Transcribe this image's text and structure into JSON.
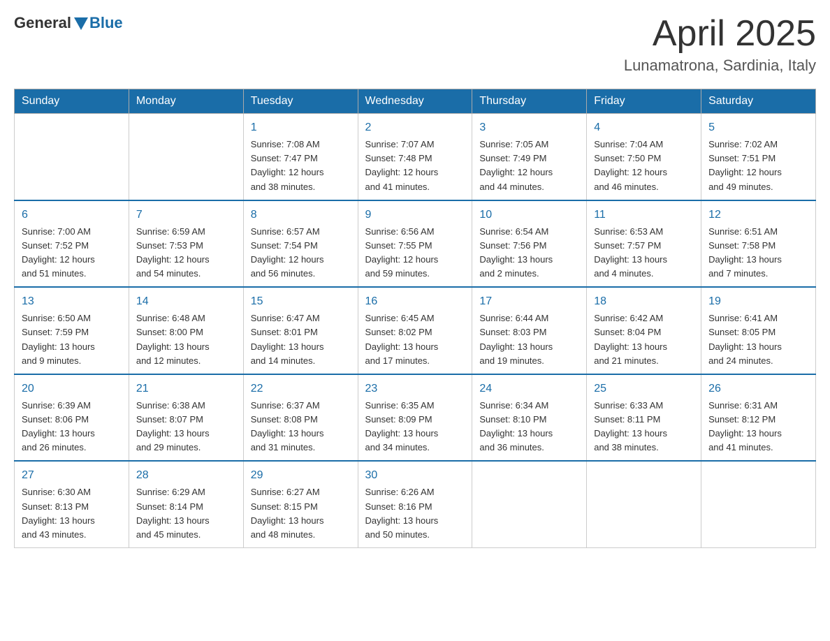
{
  "header": {
    "logo_general": "General",
    "logo_blue": "Blue",
    "title": "April 2025",
    "location": "Lunamatrona, Sardinia, Italy"
  },
  "calendar": {
    "days_of_week": [
      "Sunday",
      "Monday",
      "Tuesday",
      "Wednesday",
      "Thursday",
      "Friday",
      "Saturday"
    ],
    "weeks": [
      [
        {
          "day": "",
          "info": ""
        },
        {
          "day": "",
          "info": ""
        },
        {
          "day": "1",
          "info": "Sunrise: 7:08 AM\nSunset: 7:47 PM\nDaylight: 12 hours\nand 38 minutes."
        },
        {
          "day": "2",
          "info": "Sunrise: 7:07 AM\nSunset: 7:48 PM\nDaylight: 12 hours\nand 41 minutes."
        },
        {
          "day": "3",
          "info": "Sunrise: 7:05 AM\nSunset: 7:49 PM\nDaylight: 12 hours\nand 44 minutes."
        },
        {
          "day": "4",
          "info": "Sunrise: 7:04 AM\nSunset: 7:50 PM\nDaylight: 12 hours\nand 46 minutes."
        },
        {
          "day": "5",
          "info": "Sunrise: 7:02 AM\nSunset: 7:51 PM\nDaylight: 12 hours\nand 49 minutes."
        }
      ],
      [
        {
          "day": "6",
          "info": "Sunrise: 7:00 AM\nSunset: 7:52 PM\nDaylight: 12 hours\nand 51 minutes."
        },
        {
          "day": "7",
          "info": "Sunrise: 6:59 AM\nSunset: 7:53 PM\nDaylight: 12 hours\nand 54 minutes."
        },
        {
          "day": "8",
          "info": "Sunrise: 6:57 AM\nSunset: 7:54 PM\nDaylight: 12 hours\nand 56 minutes."
        },
        {
          "day": "9",
          "info": "Sunrise: 6:56 AM\nSunset: 7:55 PM\nDaylight: 12 hours\nand 59 minutes."
        },
        {
          "day": "10",
          "info": "Sunrise: 6:54 AM\nSunset: 7:56 PM\nDaylight: 13 hours\nand 2 minutes."
        },
        {
          "day": "11",
          "info": "Sunrise: 6:53 AM\nSunset: 7:57 PM\nDaylight: 13 hours\nand 4 minutes."
        },
        {
          "day": "12",
          "info": "Sunrise: 6:51 AM\nSunset: 7:58 PM\nDaylight: 13 hours\nand 7 minutes."
        }
      ],
      [
        {
          "day": "13",
          "info": "Sunrise: 6:50 AM\nSunset: 7:59 PM\nDaylight: 13 hours\nand 9 minutes."
        },
        {
          "day": "14",
          "info": "Sunrise: 6:48 AM\nSunset: 8:00 PM\nDaylight: 13 hours\nand 12 minutes."
        },
        {
          "day": "15",
          "info": "Sunrise: 6:47 AM\nSunset: 8:01 PM\nDaylight: 13 hours\nand 14 minutes."
        },
        {
          "day": "16",
          "info": "Sunrise: 6:45 AM\nSunset: 8:02 PM\nDaylight: 13 hours\nand 17 minutes."
        },
        {
          "day": "17",
          "info": "Sunrise: 6:44 AM\nSunset: 8:03 PM\nDaylight: 13 hours\nand 19 minutes."
        },
        {
          "day": "18",
          "info": "Sunrise: 6:42 AM\nSunset: 8:04 PM\nDaylight: 13 hours\nand 21 minutes."
        },
        {
          "day": "19",
          "info": "Sunrise: 6:41 AM\nSunset: 8:05 PM\nDaylight: 13 hours\nand 24 minutes."
        }
      ],
      [
        {
          "day": "20",
          "info": "Sunrise: 6:39 AM\nSunset: 8:06 PM\nDaylight: 13 hours\nand 26 minutes."
        },
        {
          "day": "21",
          "info": "Sunrise: 6:38 AM\nSunset: 8:07 PM\nDaylight: 13 hours\nand 29 minutes."
        },
        {
          "day": "22",
          "info": "Sunrise: 6:37 AM\nSunset: 8:08 PM\nDaylight: 13 hours\nand 31 minutes."
        },
        {
          "day": "23",
          "info": "Sunrise: 6:35 AM\nSunset: 8:09 PM\nDaylight: 13 hours\nand 34 minutes."
        },
        {
          "day": "24",
          "info": "Sunrise: 6:34 AM\nSunset: 8:10 PM\nDaylight: 13 hours\nand 36 minutes."
        },
        {
          "day": "25",
          "info": "Sunrise: 6:33 AM\nSunset: 8:11 PM\nDaylight: 13 hours\nand 38 minutes."
        },
        {
          "day": "26",
          "info": "Sunrise: 6:31 AM\nSunset: 8:12 PM\nDaylight: 13 hours\nand 41 minutes."
        }
      ],
      [
        {
          "day": "27",
          "info": "Sunrise: 6:30 AM\nSunset: 8:13 PM\nDaylight: 13 hours\nand 43 minutes."
        },
        {
          "day": "28",
          "info": "Sunrise: 6:29 AM\nSunset: 8:14 PM\nDaylight: 13 hours\nand 45 minutes."
        },
        {
          "day": "29",
          "info": "Sunrise: 6:27 AM\nSunset: 8:15 PM\nDaylight: 13 hours\nand 48 minutes."
        },
        {
          "day": "30",
          "info": "Sunrise: 6:26 AM\nSunset: 8:16 PM\nDaylight: 13 hours\nand 50 minutes."
        },
        {
          "day": "",
          "info": ""
        },
        {
          "day": "",
          "info": ""
        },
        {
          "day": "",
          "info": ""
        }
      ]
    ]
  }
}
